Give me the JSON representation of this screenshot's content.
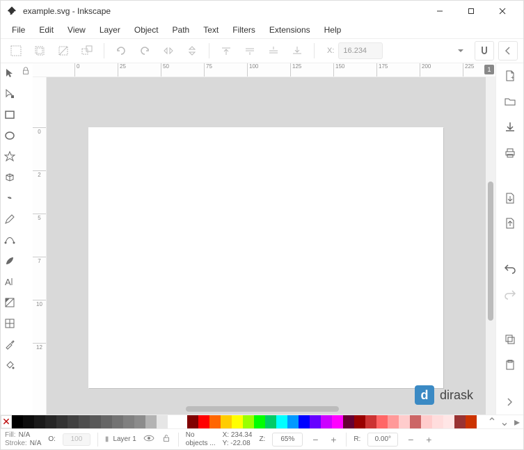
{
  "window": {
    "title": "example.svg - Inkscape"
  },
  "menu": {
    "items": [
      "File",
      "Edit",
      "View",
      "Layer",
      "Object",
      "Path",
      "Text",
      "Filters",
      "Extensions",
      "Help"
    ]
  },
  "toolbar": {
    "x_label": "X:",
    "x_value": "16.234"
  },
  "ruler": {
    "h_ticks": [
      "0",
      "25",
      "50",
      "75",
      "100",
      "125",
      "150",
      "175",
      "200",
      "225"
    ],
    "v_ticks": [
      "0",
      "2",
      "5",
      "7",
      "10",
      "12"
    ],
    "page_badge": "1"
  },
  "watermark": {
    "logo_letter": "d",
    "text": "dirask"
  },
  "palette": {
    "grays": [
      "#000000",
      "#0d0d0d",
      "#1a1a1a",
      "#262626",
      "#333333",
      "#404040",
      "#4d4d4d",
      "#595959",
      "#666666",
      "#737373",
      "#808080",
      "#8c8c8c",
      "#b3b3b3",
      "#e6e6e6"
    ],
    "colors": [
      "#800000",
      "#ff0000",
      "#ff6600",
      "#ffcc00",
      "#ffff00",
      "#99ff00",
      "#00ff00",
      "#00cc66",
      "#00ffff",
      "#0099ff",
      "#0000ff",
      "#6600ff",
      "#cc00ff",
      "#ff00ff",
      "#660033",
      "#990000",
      "#cc3333",
      "#ff6666",
      "#ff9999",
      "#ffcccc",
      "#cc6666",
      "#ffcccc",
      "#ffdddd",
      "#ffe6e6",
      "#993333",
      "#cc3300"
    ]
  },
  "status": {
    "fill_label": "Fill:",
    "fill_value": "N/A",
    "stroke_label": "Stroke:",
    "stroke_value": "N/A",
    "opacity_label": "O:",
    "opacity_value": "100",
    "layer_name": "Layer 1",
    "message_line1": "No",
    "message_line2": "objects ...",
    "coord_x_label": "X:",
    "coord_x_value": "234.34",
    "coord_y_label": "Y:",
    "coord_y_value": "-22.08",
    "zoom_label": "Z:",
    "zoom_value": "65%",
    "rotate_label": "R:",
    "rotate_value": "0.00°"
  }
}
